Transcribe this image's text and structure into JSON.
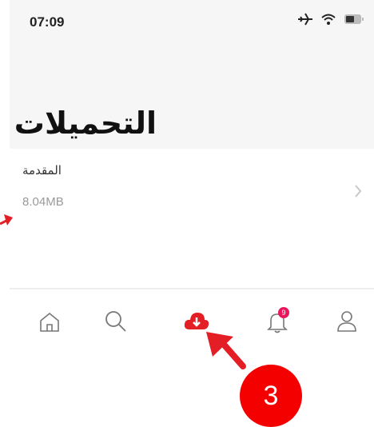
{
  "status": {
    "time": "07:09"
  },
  "page": {
    "title": "التحميلات"
  },
  "downloads": [
    {
      "title": "المقدمة",
      "size": "8.04MB"
    }
  ],
  "tabbar": {
    "tabs": [
      {
        "name": "home",
        "icon": "home-icon"
      },
      {
        "name": "search",
        "icon": "search-icon"
      },
      {
        "name": "downloads",
        "icon": "cloud-download-icon",
        "active": true
      },
      {
        "name": "notifications",
        "icon": "bell-icon",
        "badge": "9"
      },
      {
        "name": "profile",
        "icon": "user-icon"
      }
    ]
  },
  "annotation": {
    "step": "3"
  },
  "colors": {
    "accent": "#e31e24",
    "badge": "#e8175d",
    "annotation": "#f40000"
  }
}
